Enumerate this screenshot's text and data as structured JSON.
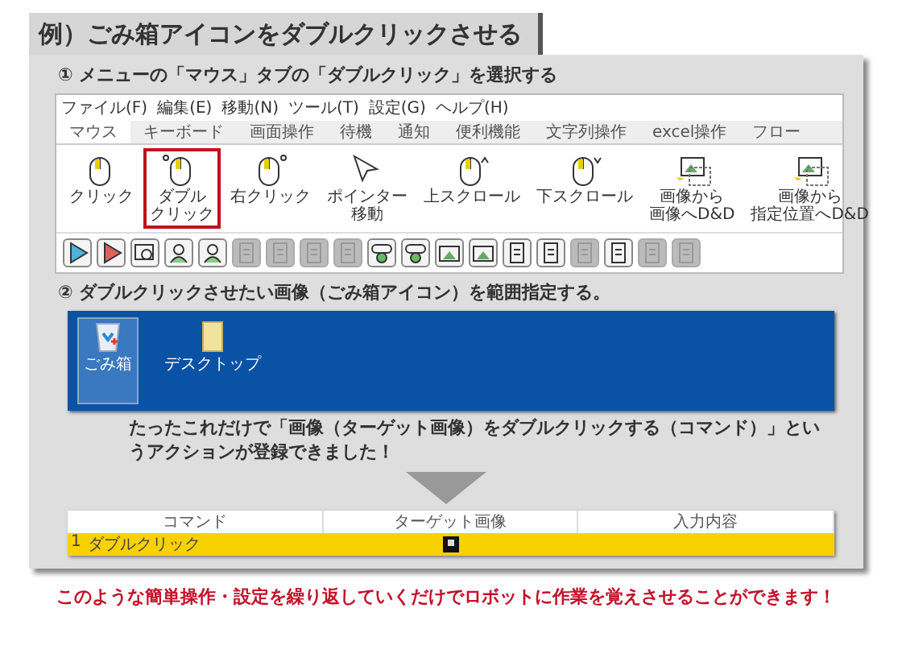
{
  "title": "例）ごみ箱アイコンをダブルクリックさせる",
  "step1": {
    "heading": "① メニューの「マウス」タブの「ダブルクリック」を選択する",
    "menu_bar": [
      "ファイル(F)",
      "編集(E)",
      "移動(N)",
      "ツール(T)",
      "設定(G)",
      "ヘルプ(H)"
    ],
    "tabs": [
      {
        "label": "マウス",
        "selected": true
      },
      {
        "label": "キーボード",
        "selected": false
      },
      {
        "label": "画面操作",
        "selected": false
      },
      {
        "label": "待機",
        "selected": false
      },
      {
        "label": "通知",
        "selected": false
      },
      {
        "label": "便利機能",
        "selected": false
      },
      {
        "label": "文字列操作",
        "selected": false
      },
      {
        "label": "excel操作",
        "selected": false
      },
      {
        "label": "フロー",
        "selected": false
      }
    ],
    "ribbon": [
      {
        "lines": [
          "クリック"
        ],
        "kind": "click",
        "selected": false
      },
      {
        "lines": [
          "ダブル",
          "クリック"
        ],
        "kind": "double",
        "selected": true
      },
      {
        "lines": [
          "右クリック"
        ],
        "kind": "right",
        "selected": false
      },
      {
        "lines": [
          "ポインター",
          "移動"
        ],
        "kind": "pointer",
        "selected": false
      },
      {
        "lines": [
          "上スクロール"
        ],
        "kind": "up",
        "selected": false
      },
      {
        "lines": [
          "下スクロール"
        ],
        "kind": "down",
        "selected": false
      },
      {
        "lines": [
          "画像から",
          "画像へD&D"
        ],
        "kind": "image",
        "selected": false
      },
      {
        "lines": [
          "画像から",
          "指定位置へD&D"
        ],
        "kind": "image",
        "selected": false
      }
    ],
    "toolbar": [
      {
        "kind": "play",
        "color": "#4fb3d9",
        "disabled": false
      },
      {
        "kind": "play",
        "color": "#e06060",
        "disabled": false
      },
      {
        "kind": "search",
        "disabled": false
      },
      {
        "kind": "person",
        "disabled": false
      },
      {
        "kind": "person",
        "disabled": false
      },
      {
        "kind": "doc",
        "disabled": true
      },
      {
        "kind": "doc",
        "disabled": true
      },
      {
        "kind": "doc",
        "disabled": true
      },
      {
        "kind": "doc",
        "disabled": true
      },
      {
        "kind": "toggle",
        "disabled": false
      },
      {
        "kind": "toggle",
        "disabled": false
      },
      {
        "kind": "photo",
        "disabled": false
      },
      {
        "kind": "photo",
        "disabled": false
      },
      {
        "kind": "doc",
        "disabled": false
      },
      {
        "kind": "doc",
        "disabled": false
      },
      {
        "kind": "doc",
        "disabled": true
      },
      {
        "kind": "doc",
        "disabled": false
      },
      {
        "kind": "doc",
        "disabled": true
      },
      {
        "kind": "doc",
        "disabled": true
      }
    ]
  },
  "step2": {
    "heading": "② ダブルクリックさせたい画像（ごみ箱アイコン）を範囲指定する。",
    "desktop_icons": [
      {
        "label": "ごみ箱",
        "kind": "bin",
        "selected": true
      },
      {
        "label": "デスクトップ",
        "kind": "folder",
        "selected": false
      }
    ],
    "message": "たったこれだけで「画像（ターゲット画像）をダブルクリックする（コマンド）」というアクションが登録できました！"
  },
  "table": {
    "columns": [
      "コマンド",
      "ターゲット画像",
      "入力内容"
    ],
    "rows": [
      {
        "index": "1",
        "command": "ダブルクリック",
        "selected": true
      }
    ]
  },
  "footer": "このような簡単操作・設定を繰り返していくだけでロボットに作業を覚えさせることができます！"
}
